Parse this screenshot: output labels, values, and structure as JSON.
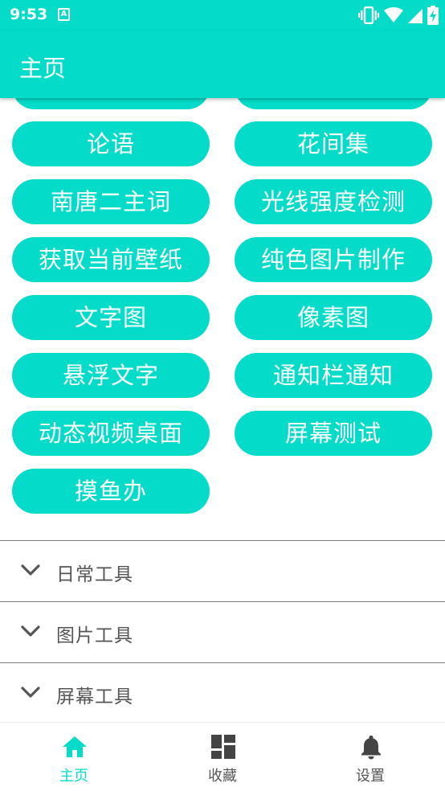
{
  "status_bar": {
    "time": "9:53",
    "notification_icon": "A"
  },
  "app_bar": {
    "title": "主页"
  },
  "tool_buttons": [
    "论语",
    "花间集",
    "南唐二主词",
    "光线强度检测",
    "获取当前壁纸",
    "纯色图片制作",
    "文字图",
    "像素图",
    "悬浮文字",
    "通知栏通知",
    "动态视频桌面",
    "屏幕测试",
    "摸鱼办"
  ],
  "sections": [
    {
      "label": "日常工具",
      "icon": "chevron-down-icon"
    },
    {
      "label": "图片工具",
      "icon": "chevron-down-icon"
    },
    {
      "label": "屏幕工具",
      "icon": "chevron-down-icon"
    }
  ],
  "bottom_nav": [
    {
      "label": "主页",
      "icon": "home-icon",
      "active": true
    },
    {
      "label": "收藏",
      "icon": "dashboard-icon",
      "active": false
    },
    {
      "label": "设置",
      "icon": "bell-icon",
      "active": false
    }
  ],
  "colors": {
    "accent": "#05dbc9",
    "nav_active": "#05dbc9",
    "nav_inactive": "#555555",
    "icon_inactive": "#444444",
    "section_text": "#555555"
  }
}
